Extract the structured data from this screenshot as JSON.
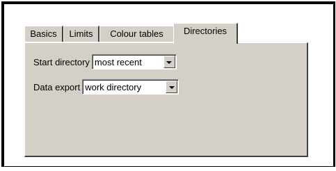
{
  "tabs": [
    {
      "label": "Basics",
      "active": false
    },
    {
      "label": "Limits",
      "active": false
    },
    {
      "label": "Colour tables",
      "active": false
    },
    {
      "label": "Directories",
      "active": true
    }
  ],
  "directories": {
    "start_directory": {
      "label": "Start directory",
      "value": "most recent",
      "icon": "chevron-down-icon"
    },
    "data_export": {
      "label": "Data export",
      "value": "work directory",
      "icon": "chevron-down-icon"
    }
  },
  "colors": {
    "panel": "#d4d0c8",
    "highlight": "#ffffff",
    "shadow": "#404040",
    "frame": "#000000"
  }
}
